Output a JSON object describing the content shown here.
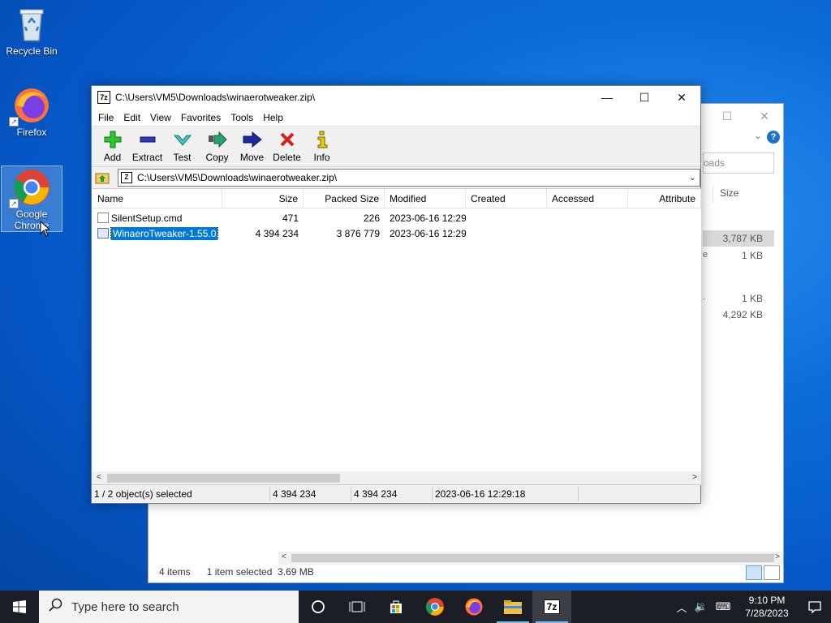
{
  "desktop": {
    "icons": [
      {
        "label": "Recycle Bin",
        "icon": "recycle-bin-icon"
      },
      {
        "label": "Firefox",
        "icon": "firefox-icon"
      },
      {
        "label": "Google Chrome",
        "icon": "chrome-icon"
      }
    ]
  },
  "bg_explorer": {
    "search_fragment": "oads",
    "size_header": "Size",
    "rows": [
      "3,787 KB",
      "1 KB",
      "1 KB",
      "4,292 KB"
    ],
    "row_marks": [
      "e",
      "."
    ],
    "status_items": "4 items",
    "status_selected": "1 item selected",
    "status_size": "3.69 MB"
  },
  "window": {
    "title": "C:\\Users\\VM5\\Downloads\\winaerotweaker.zip\\",
    "app_icon": "7z",
    "menu": [
      "File",
      "Edit",
      "View",
      "Favorites",
      "Tools",
      "Help"
    ],
    "toolbar": [
      {
        "label": "Add",
        "icon": "add-icon"
      },
      {
        "label": "Extract",
        "icon": "extract-icon"
      },
      {
        "label": "Test",
        "icon": "test-icon"
      },
      {
        "label": "Copy",
        "icon": "copy-icon"
      },
      {
        "label": "Move",
        "icon": "move-icon"
      },
      {
        "label": "Delete",
        "icon": "delete-icon"
      },
      {
        "label": "Info",
        "icon": "info-icon"
      }
    ],
    "address": "C:\\Users\\VM5\\Downloads\\winaerotweaker.zip\\",
    "columns": [
      "Name",
      "Size",
      "Packed Size",
      "Modified",
      "Created",
      "Accessed",
      "Attribute"
    ],
    "files": [
      {
        "name": "SilentSetup.cmd",
        "size": "471",
        "packed": "226",
        "modified": "2023-06-16 12:29",
        "created": "",
        "accessed": "",
        "attr": "",
        "selected": false
      },
      {
        "name": "WinaeroTweaker-1.55.0....",
        "size": "4 394 234",
        "packed": "3 876 779",
        "modified": "2023-06-16 12:29",
        "created": "",
        "accessed": "",
        "attr": "",
        "selected": true
      }
    ],
    "status": {
      "selection": "1 / 2 object(s) selected",
      "size": "4 394 234",
      "packed": "4 394 234",
      "modified": "2023-06-16 12:29:18"
    }
  },
  "taskbar": {
    "search_placeholder": "Type here to search",
    "apps": [
      "cortana-icon",
      "task-view-icon",
      "store-icon",
      "chrome-icon",
      "firefox-icon",
      "file-explorer-icon",
      "7zip-icon"
    ],
    "seven_zip_label": "7z",
    "time": "9:10 PM",
    "date": "7/28/2023"
  },
  "colors": {
    "accent": "#0078d7",
    "taskbar": "#1b1e24",
    "desktop": "#0b6cd8"
  }
}
